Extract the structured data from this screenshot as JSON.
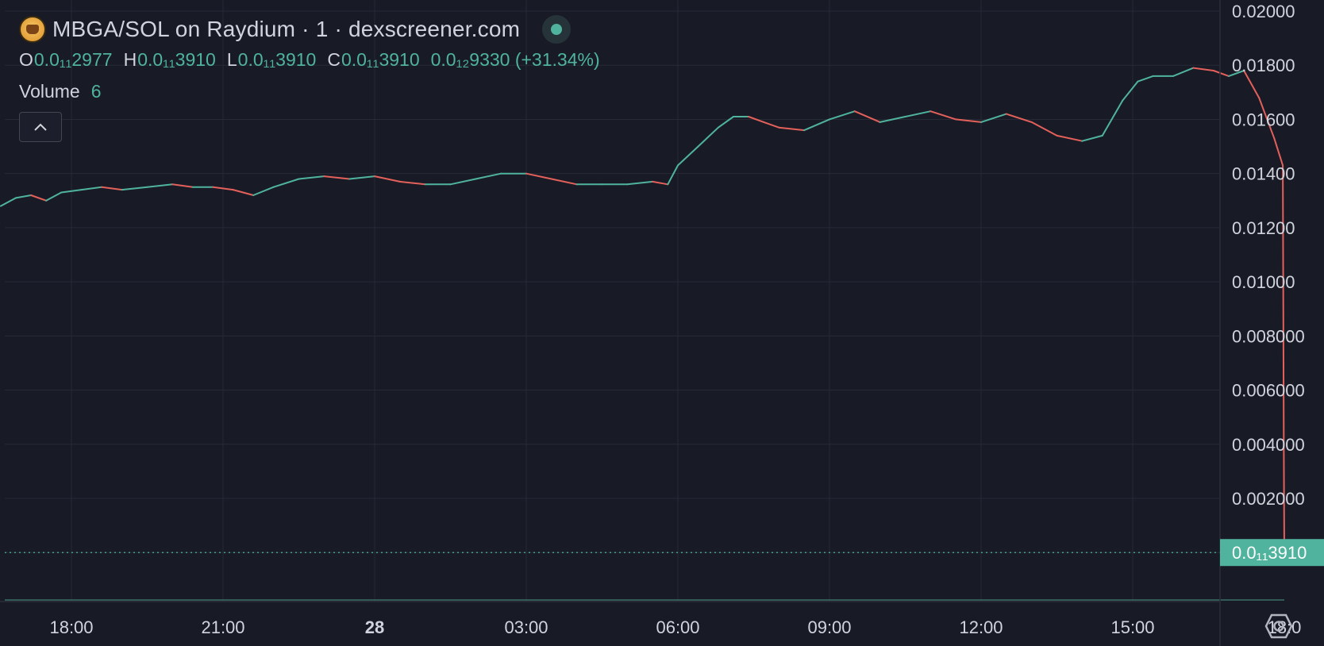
{
  "header": {
    "title": "MBGA/SOL on Raydium · 1 · dexscreener.com",
    "icons": {
      "logo": "coin-logo-icon",
      "status": "live-status-dot",
      "collapse": "chevron-up-icon",
      "settings": "settings-icon"
    }
  },
  "ohlc": {
    "o_label": "O",
    "o_value": "0.0₁₁2977",
    "h_label": "H",
    "h_value": "0.0₁₁3910",
    "l_label": "L",
    "l_value": "0.0₁₁3910",
    "c_label": "C",
    "c_value": "0.0₁₁3910",
    "change": "0.0₁₂9330 (+31.34%)"
  },
  "volume": {
    "label": "Volume",
    "value": "6"
  },
  "colors": {
    "background": "#181b26",
    "grid": "#262a36",
    "up": "#4fb39d",
    "down": "#e4605a",
    "axis_text": "#d1d4dc",
    "price_tag_bg": "#4fb39d"
  },
  "chart_data": {
    "type": "line",
    "y_ticks": [
      "0.02000",
      "0.01800",
      "0.01600",
      "0.01400",
      "0.01200",
      "0.01000",
      "0.008000",
      "0.006000",
      "0.004000",
      "0.002000"
    ],
    "x_ticks": [
      "18:00",
      "21:00",
      "28",
      "03:00",
      "06:00",
      "09:00",
      "12:00",
      "15:00",
      "18:0"
    ],
    "ylim": [
      0,
      0.0202
    ],
    "xlim_hours": [
      16.6,
      42.0
    ],
    "grid": true,
    "current_price_label": "0.0₁₁3910",
    "current_price_value": 3.91e-13,
    "series": [
      {
        "x": [
          16.6,
          16.9,
          17.2,
          17.5,
          17.8,
          18.2,
          18.6,
          19.0,
          19.5,
          20.0,
          20.4,
          20.8,
          21.2,
          21.6,
          22.0,
          22.5,
          23.0,
          23.5,
          24.0,
          24.5,
          25.0,
          25.5,
          26.0,
          26.5,
          27.0,
          27.5,
          28.0,
          28.5,
          29.0,
          29.5,
          29.8,
          30.0,
          30.4,
          30.8,
          31.1,
          31.4,
          31.7,
          32.0,
          32.5,
          33.0,
          33.5,
          34.0,
          34.5,
          35.0,
          35.5,
          36.0,
          36.5,
          37.0,
          37.5,
          38.0,
          38.4,
          38.8,
          39.1,
          39.4,
          39.8,
          40.2,
          40.6,
          40.9,
          41.2,
          41.5,
          41.8,
          41.97,
          41.99,
          42.0
        ],
        "y": [
          0.0128,
          0.0131,
          0.0132,
          0.013,
          0.0133,
          0.0134,
          0.0135,
          0.0134,
          0.0135,
          0.0136,
          0.0135,
          0.0135,
          0.0134,
          0.0132,
          0.0135,
          0.0138,
          0.0139,
          0.0138,
          0.0139,
          0.0137,
          0.0136,
          0.0136,
          0.0138,
          0.014,
          0.014,
          0.0138,
          0.0136,
          0.0136,
          0.0136,
          0.0137,
          0.0136,
          0.0143,
          0.015,
          0.0157,
          0.0161,
          0.0161,
          0.0159,
          0.0157,
          0.0156,
          0.016,
          0.0163,
          0.0159,
          0.0161,
          0.0163,
          0.016,
          0.0159,
          0.0162,
          0.0159,
          0.0154,
          0.0152,
          0.0154,
          0.0167,
          0.0174,
          0.0176,
          0.0176,
          0.0179,
          0.0178,
          0.0176,
          0.0178,
          0.0168,
          0.0153,
          0.0143,
          0.0036,
          4e-11
        ]
      }
    ]
  }
}
